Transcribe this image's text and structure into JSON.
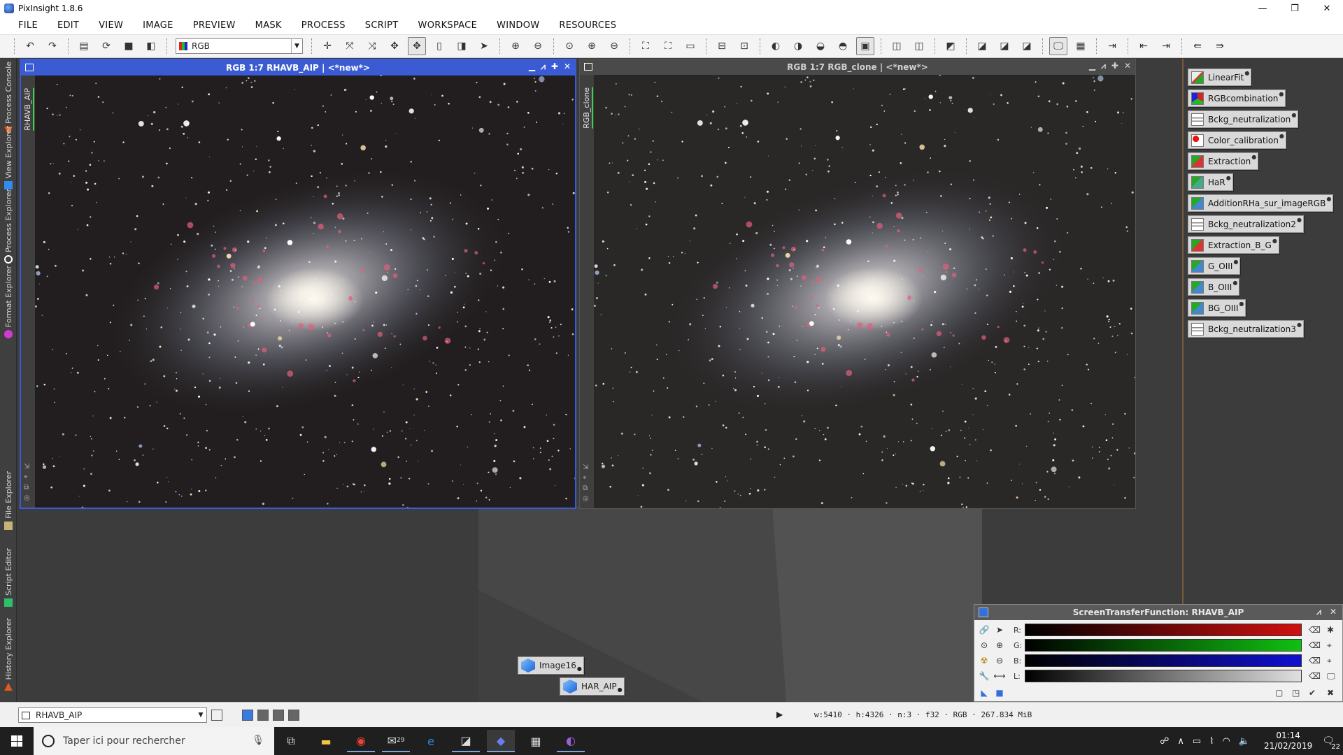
{
  "window": {
    "title": "PixInsight 1.8.6",
    "controls": [
      "—",
      "❐",
      "✕"
    ]
  },
  "menu": [
    "FILE",
    "EDIT",
    "VIEW",
    "IMAGE",
    "PREVIEW",
    "MASK",
    "PROCESS",
    "SCRIPT",
    "WORKSPACE",
    "WINDOW",
    "RESOURCES"
  ],
  "toolbar": {
    "channel_select": "RGB"
  },
  "side_tabs": [
    "Process Console",
    "View Explorer",
    "Process Explorer",
    "Format Explorer",
    "File Explorer",
    "Script Editor",
    "History Explorer"
  ],
  "image_windows": [
    {
      "title": "RGB 1:7 RHAVB_AIP | <*new*>",
      "view_id": "RHAVB_AIP",
      "active": true
    },
    {
      "title": "RGB 1:7 RGB_clone | <*new*>",
      "view_id": "RGB_clone",
      "active": false
    }
  ],
  "process_icons": [
    "LinearFit",
    "RGBcombination",
    "Bckg_neutralization",
    "Color_calibration",
    "Extraction",
    "HaR",
    "AdditionRHa_sur_imageRGB",
    "Bckg_neutralization2",
    "Extraction_B_G",
    "G_OIII",
    "B_OIII",
    "BG_OIII",
    "Bckg_neutralization3"
  ],
  "minimized_images": [
    "Image16",
    "HAR_AIP"
  ],
  "stf": {
    "title": "ScreenTransferFunction: RHAVB_AIP",
    "channels": [
      {
        "label": "R:",
        "color": "#d01010"
      },
      {
        "label": "G:",
        "color": "#10c010"
      },
      {
        "label": "B:",
        "color": "#1010d0"
      },
      {
        "label": "L:",
        "color": "#e0e0e0"
      }
    ]
  },
  "viewbar": {
    "current_view": "RHAVB_AIP",
    "status": "w:5410 · h:4326 · n:3 · f32 · RGB · 267.834 MiB"
  },
  "taskbar": {
    "search_placeholder": "Taper ici pour rechercher",
    "mail_badge": "29",
    "time": "01:14",
    "date": "21/02/2019",
    "notifications": "22"
  },
  "colors": {
    "active_titlebar": "#3a5bd4",
    "inactive_titlebar": "#4a4a4a",
    "workspace": "#3c3c3c"
  }
}
